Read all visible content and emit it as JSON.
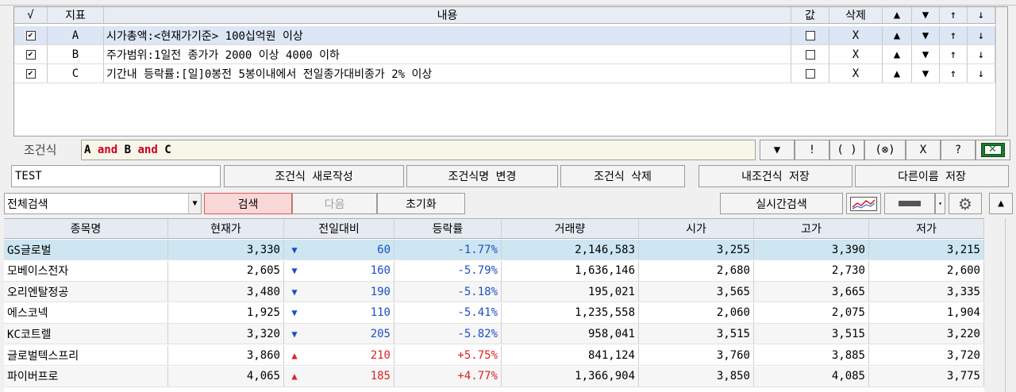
{
  "condition_table": {
    "headers": {
      "check": "√",
      "index": "지표",
      "content": "내용",
      "value": "값",
      "delete": "삭제",
      "up": "▲",
      "down": "▼",
      "top": "↑",
      "bottom": "↓"
    },
    "rows": [
      {
        "index": "A",
        "content": "시가총액:<현재가기준> 100십억원 이상",
        "del": "X",
        "up": "▲",
        "down": "▼",
        "top": "↑",
        "bottom": "↓"
      },
      {
        "index": "B",
        "content": "주가범위:1일전 종가가 2000 이상 4000 이하",
        "del": "X",
        "up": "▲",
        "down": "▼",
        "top": "↑",
        "bottom": "↓"
      },
      {
        "index": "C",
        "content": "기간내 등락률:[일]0봉전 5봉이내에서 전일종가대비종가 2% 이상",
        "del": "X",
        "up": "▲",
        "down": "▼",
        "top": "↑",
        "bottom": "↓"
      }
    ]
  },
  "formula": {
    "label": "조건식",
    "tokens": [
      {
        "text": "A",
        "kind": "ident"
      },
      {
        "text": " and ",
        "kind": "op"
      },
      {
        "text": "B",
        "kind": "ident"
      },
      {
        "text": " and ",
        "kind": "op"
      },
      {
        "text": "C",
        "kind": "ident"
      }
    ],
    "buttons": [
      "▼",
      "!",
      "( )",
      "(⊗)",
      "X",
      "?"
    ]
  },
  "name_input": {
    "value": "TEST"
  },
  "actions": {
    "new": "조건식 새로작성",
    "rename": "조건식명 변경",
    "delete": "조건식 삭제",
    "save": "내조건식 저장",
    "save_as": "다른이름 저장"
  },
  "search_bar": {
    "scope": "전체검색",
    "search": "검색",
    "next": "다음",
    "reset": "초기화",
    "realtime": "실시간검색"
  },
  "grid": {
    "headers": [
      "종목명",
      "현재가",
      "전일대비",
      "등락률",
      "거래량",
      "시가",
      "고가",
      "저가"
    ],
    "rows": [
      {
        "name": "GS글로벌",
        "price": "3,330",
        "dir": "▼",
        "change": "60",
        "rate": "-1.77%",
        "volume": "2,146,583",
        "open": "3,255",
        "high": "3,390",
        "low": "3,215",
        "up": false,
        "selected": true
      },
      {
        "name": "모베이스전자",
        "price": "2,605",
        "dir": "▼",
        "change": "160",
        "rate": "-5.79%",
        "volume": "1,636,146",
        "open": "2,680",
        "high": "2,730",
        "low": "2,600",
        "up": false
      },
      {
        "name": "오리엔탈정공",
        "price": "3,480",
        "dir": "▼",
        "change": "190",
        "rate": "-5.18%",
        "volume": "195,021",
        "open": "3,565",
        "high": "3,665",
        "low": "3,335",
        "up": false
      },
      {
        "name": "에스코넥",
        "price": "1,925",
        "dir": "▼",
        "change": "110",
        "rate": "-5.41%",
        "volume": "1,235,558",
        "open": "2,060",
        "high": "2,075",
        "low": "1,904",
        "up": false
      },
      {
        "name": "KC코트렐",
        "price": "3,320",
        "dir": "▼",
        "change": "205",
        "rate": "-5.82%",
        "volume": "958,041",
        "open": "3,515",
        "high": "3,515",
        "low": "3,220",
        "up": false
      },
      {
        "name": "글로벌텍스프리",
        "price": "3,860",
        "dir": "▲",
        "change": "210",
        "rate": "+5.75%",
        "volume": "841,124",
        "open": "3,760",
        "high": "3,885",
        "low": "3,720",
        "up": true
      },
      {
        "name": "파이버프로",
        "price": "4,065",
        "dir": "▲",
        "change": "185",
        "rate": "+4.77%",
        "volume": "1,366,904",
        "open": "3,850",
        "high": "4,085",
        "low": "3,775",
        "up": true
      }
    ]
  },
  "colors": {
    "down": "#1a4fc8",
    "up": "#e02020",
    "op": "#c8001e",
    "excel": "#1e7a2e"
  }
}
